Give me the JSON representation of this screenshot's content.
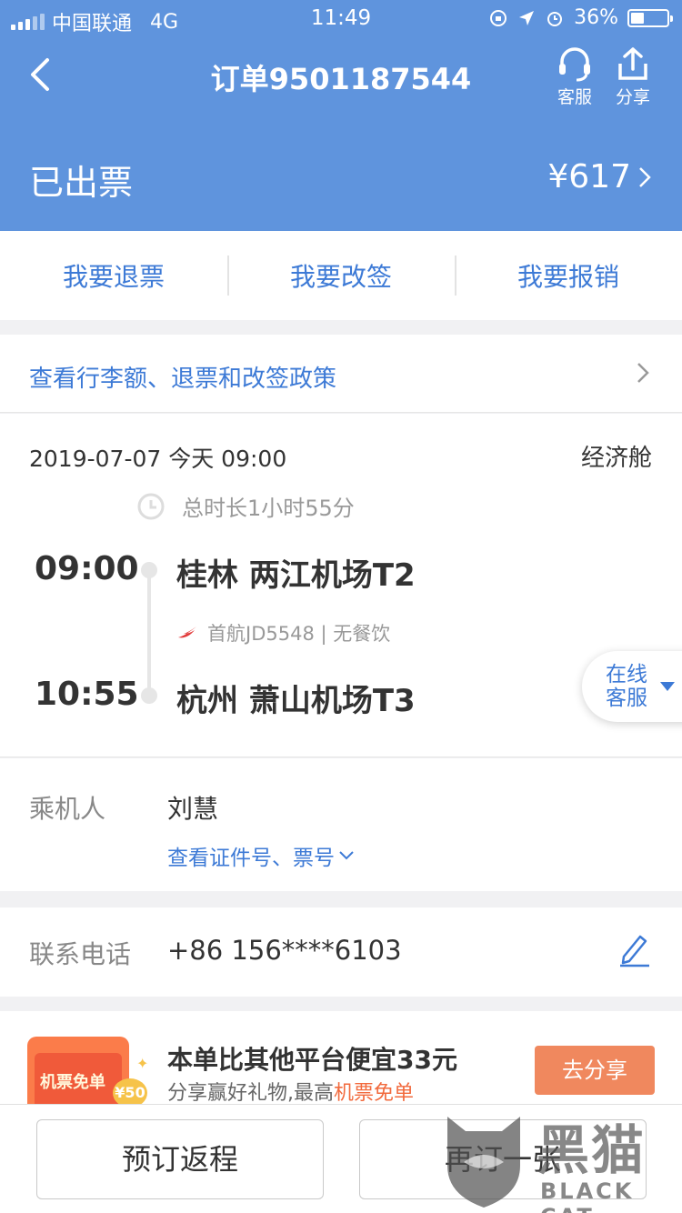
{
  "statusbar": {
    "carrier": "中国联通",
    "network": "4G",
    "time": "11:49",
    "battery": "36%"
  },
  "header": {
    "order_title": "订单9501187544",
    "service_label": "客服",
    "share_label": "分享",
    "status": "已出票",
    "price": "¥617"
  },
  "actions": {
    "refund": "我要退票",
    "change": "我要改签",
    "reimburse": "我要报销"
  },
  "policy_link": "查看行李额、退票和改签政策",
  "flight": {
    "date": "2019-07-07  今天 09:00",
    "cabin": "经济舱",
    "duration": "总时长1小时55分",
    "dep_time": "09:00",
    "dep_city": "桂林 两江机场T2",
    "flight_info": "首航JD5548 | 无餐饮",
    "arr_time": "10:55",
    "arr_city": "杭州 萧山机场T3"
  },
  "online_service": "在线客服",
  "passenger": {
    "label": "乘机人",
    "name": "刘慧",
    "id_link": "查看证件号、票号"
  },
  "contact": {
    "label": "联系电话",
    "phone": "+86 156****6103"
  },
  "promo": {
    "image_tag": "机票免单",
    "coin": "¥50",
    "title": "本单比其他平台便宜33元",
    "sub_prefix": "分享赢好礼物,最高",
    "sub_highlight": "机票免单",
    "button": "去分享"
  },
  "bottom": {
    "return_trip": "预订返程",
    "book_again": "再订一张"
  },
  "watermark": {
    "cn": "黑猫",
    "en": "BLACK CAT"
  },
  "colors": {
    "header_bg": "#5f94dd",
    "link_blue": "#3d7ad6",
    "promo_orange": "#f0885e"
  }
}
